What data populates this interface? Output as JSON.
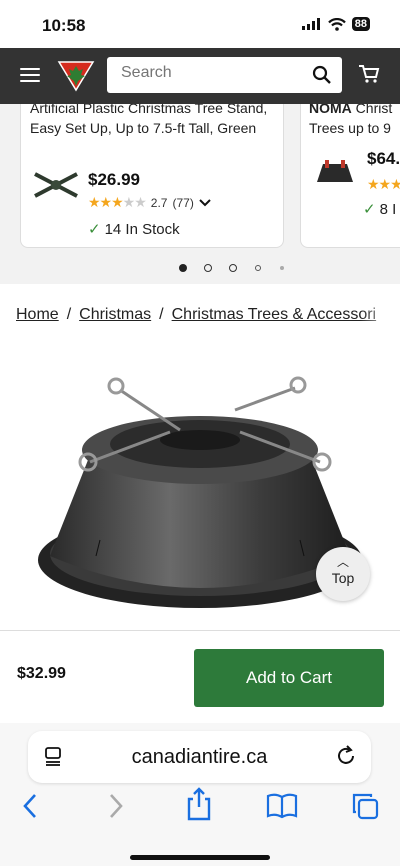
{
  "status": {
    "time": "10:58",
    "battery": "88"
  },
  "header": {
    "search_placeholder": "Search"
  },
  "carousel": {
    "cards": [
      {
        "title": "Artificial Plastic Christmas Tree Stand, Easy Set Up, Up to 7.5-ft Tall, Green",
        "price": "$26.99",
        "rating": "2.7",
        "reviews": "(77)",
        "stock": "14 In Stock"
      },
      {
        "title_bold": "NOMA",
        "title_rest": " Christ Trees up to 9",
        "price": "$64.",
        "stock": "8 I"
      }
    ]
  },
  "breadcrumb": [
    "Home",
    "Christmas",
    "Christmas Trees & Accessori"
  ],
  "breadcrumb_sep": "/",
  "top_button": {
    "label": "Top"
  },
  "buy": {
    "price": "$32.99",
    "add_to_cart": "Add to Cart"
  },
  "browser": {
    "url": "canadiantire.ca"
  },
  "colors": {
    "header": "#333333",
    "accent_red": "#d52b1e",
    "button_green": "#2d7a3a",
    "star": "#f4a61e",
    "link_blue": "#1a6fe0"
  }
}
